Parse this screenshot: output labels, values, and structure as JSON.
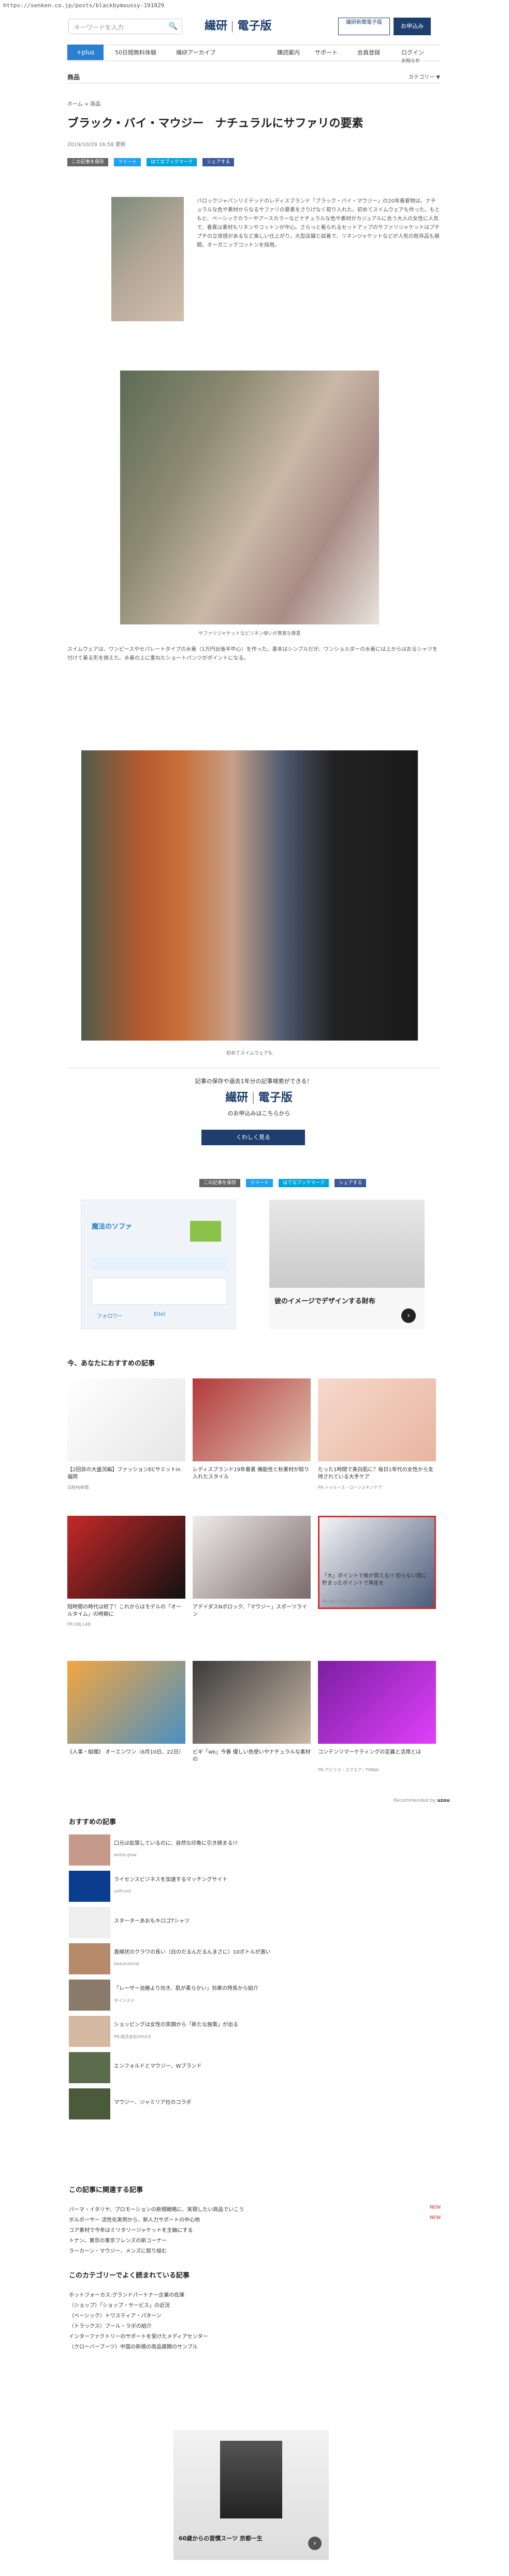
{
  "url": "https://senken.co.jp/posts/blackbymoussy-191029",
  "header": {
    "search_placeholder": "キーワードを入力",
    "logo_left": "繊研",
    "logo_right": "電子版",
    "promo_label": "繊研新聞電子版",
    "signup_label": "お申込み"
  },
  "nav": {
    "plus": "+plus",
    "items": [
      "50日間無料体験",
      "繊研アーカイブ",
      "購読案内",
      "サポート",
      "会員登録",
      "ログイン",
      "お知らせ"
    ]
  },
  "subnav": {
    "left": "商品",
    "right": "カテゴリー ▼"
  },
  "article": {
    "breadcrumb": "ホーム > 商品",
    "title": "ブラック・バイ・マウジー　ナチュラルにサファリの要素",
    "date": "2019/10/29 16:58 更新",
    "share": [
      "この記事を保存",
      "ツイート",
      "はてなブックマーク",
      "シェアする"
    ],
    "p1": "バロックジャパンリミテッドのレディスブランド「ブラック・バイ・マウジー」の20年春夏物は、ナチュラルな色や素材からなるサファリの要素をさりげなく取り入れた。初めてスイムウェアも作った。もともと、ベーシックカラーやアースカラーなどナチュラルな色や素材がカジュアルに合う大人の女性に人気で、春夏は素材もリネンやコットンが中心。さらっと着られるセットアップのサファリジャケットはプチプチの立体感があるなど楽しい仕上がり。大型店舗と試着で、リネンジャケットなどが人気の既存品も展開。オーガニックコットンを採用。",
    "caption1": "サファリジャケットなどリネン使いが豊富な春夏",
    "p2": "スイムウェアは、ワンピースやセパレートタイプの水着（1万円台後半中心）を作った。基本はシンプルだが、ワンショルダーの水着には上からはおるシャツを付けて着る形を揃えた。水着の上に重ねたショートパンツがポイントになる。",
    "caption2": "初めてスイムウェアも"
  },
  "promo": {
    "tagline": "記事の保存や過去1年分の記事検索ができる！",
    "logo_left": "繊研",
    "logo_right": "電子版",
    "subline": "のお申込みはこちらから",
    "cta": "くわしく見る"
  },
  "ads": {
    "ad1_title": "魔法のソファ",
    "ad1_cta1": "フォロワー",
    "ad1_cta2": "Eitel",
    "ad2_text": "彼のイメージでデザインする財布",
    "ad3_text": "60歳からの習慣スーツ 京都一生"
  },
  "recommended": {
    "title": "今、あなたにおすすめの記事",
    "cards": [
      {
        "text": "【2回目の大盛況編】ファッションECサミットin福岡",
        "src": "日経MJ新聞"
      },
      {
        "text": "レディスブランド19年春夏 機能性と秋素材が取り入れたスタイル",
        "src": ""
      },
      {
        "text": "たった1時間で美白肌に？毎日1年代の女性から支持されている大手ケア",
        "src": "PR:トゥルース・ローンスキンケア"
      },
      {
        "text": "短時間の時代は終了！これからはモデルの「オールタイム」の時期に",
        "src": "PR:OBJ.LAB"
      },
      {
        "text": "アデイダスNボロック、「マウジー」スポーツライン",
        "src": ""
      },
      {
        "text": "「大」ポイントで株が買える!? 知らない間に貯まったポイントで資産を",
        "src": "PR:ほけんのシャナイ比較"
      },
      {
        "text": "《人事・組織》 オーエンワン（6月10日、22日）",
        "src": ""
      },
      {
        "text": "ビギ「wb」今春 優しい色使いやナチュラルな素材の",
        "src": ""
      },
      {
        "text": "コンテンツマーケティングの定義と活用とは",
        "src": "PR:アビリス・スクエア／FINNA"
      }
    ],
    "powered": "Recommended by",
    "powered_brand": "uzou"
  },
  "related": {
    "title": "おすすめの記事",
    "items": [
      {
        "text": "口元は拡張しているのに、自然な印象に引き締まる!?",
        "src": "white-glow"
      },
      {
        "text": "ライセンスビジネスを加速するマッチングサイト",
        "src": "selfrund"
      },
      {
        "text": "スターターあおもキロゴTシャツ",
        "src": ""
      },
      {
        "text": "直線状のクラワの長い（白のだるんだるんまさに）10ボトルが激い",
        "src": "beaututorial"
      },
      {
        "text": "「レーザー治療より効き、肌が柔らかい」効果の特長から紹介",
        "src": "ダインスル"
      },
      {
        "text": "ショッピングは女性の笑顔から「新たな施策」が出る",
        "src": "PR:株式会社SHUCE"
      },
      {
        "text": "エンフォルドとマウジー、Wブランド",
        "src": ""
      },
      {
        "text": "マウジー、ジャミリア社のコラボ",
        "src": ""
      }
    ]
  },
  "about": {
    "title": "この記事に関連する記事",
    "items": [
      "バーマ・イタリヤ、プロモーションの新規戦略に、実現したい商品でいこう",
      "ボルボーサー 活性化実例から、新人力サポートの中心地",
      "コア素材で今年はミリタリージャケットを主軸にする",
      "トナン、東京の東京フレンズの新コーナー",
      "ラーカーン・マウジー、メンズに取り組む"
    ],
    "new": "NEW"
  },
  "category": {
    "title": "このカテゴリーでよく読まれている記事",
    "items": [
      "ホットフォーカス:グランドパートナー企業の在庫",
      "（ショップ）「ショップ・サービス」の近況",
      "（ベーシック）トワスティア・パターン",
      "（トラックス）プール・ラボの紹介",
      "インターファクトリーのサポートを受けたメディアセンター",
      "（クローバーブーツ）中国の新規の商品展開のサンプル"
    ]
  },
  "colors": {
    "brand": "#1e3f6e",
    "plus": "#2a7fd0",
    "twitter": "#1da1f2",
    "hatena": "#00a4de",
    "facebook": "#3b5998",
    "ad_highlight": "#d32f2f"
  }
}
